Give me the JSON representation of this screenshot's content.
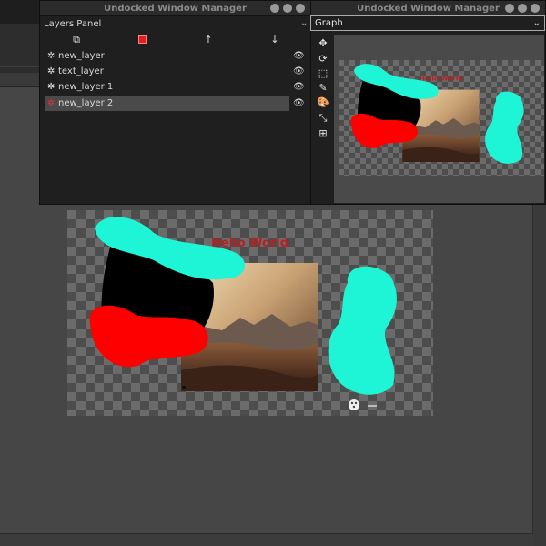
{
  "window_title": "Undocked Window Manager",
  "layers_panel": {
    "title": "Layers Panel",
    "tools": [
      {
        "name": "duplicate-layer-icon",
        "glyph": "⧉"
      },
      {
        "name": "delete-layer-icon",
        "glyph": "■"
      },
      {
        "name": "move-layer-up-icon",
        "glyph": "🡑"
      },
      {
        "name": "move-layer-down-icon",
        "glyph": "🡓"
      }
    ],
    "layers": [
      {
        "label": "new_layer",
        "visible": true,
        "selected": false
      },
      {
        "label": "text_layer",
        "visible": true,
        "selected": false
      },
      {
        "label": "new_layer 1",
        "visible": true,
        "selected": false
      },
      {
        "label": "new_layer 2",
        "visible": true,
        "selected": true
      }
    ]
  },
  "graph_panel": {
    "tab_label": "Graph",
    "tools": [
      "move-icon",
      "rotate-icon",
      "select-icon",
      "brush-icon",
      "palette-icon",
      "eyedropper-icon",
      "add-icon"
    ]
  },
  "canvas": {
    "text_layer_text": "Hello World",
    "colors": {
      "cyan": "#1df5d6",
      "red": "#ff0000",
      "black": "#000000",
      "text": "#b22222"
    }
  },
  "window_buttons": [
    "minimize",
    "maximize",
    "close"
  ]
}
